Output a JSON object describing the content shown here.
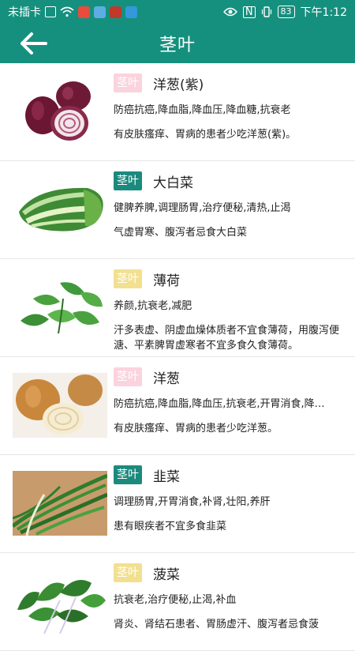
{
  "status_bar": {
    "carrier": "未插卡",
    "battery": "83",
    "time": "下午1:12"
  },
  "header": {
    "title": "茎叶"
  },
  "items": [
    {
      "badge": "茎叶",
      "badge_color": "#fbd3de",
      "name": "洋葱(紫)",
      "effect": "防癌抗癌,降血脂,降血压,降血糖,抗衰老",
      "avoid": "有皮肤瘙痒、胃病的患者少吃洋葱(紫)。",
      "image": "red-onion"
    },
    {
      "badge": "茎叶",
      "badge_color": "#1b8a7e",
      "name": "大白菜",
      "effect": "健脾养脾,调理肠胃,治疗便秘,清热,止渴",
      "avoid": "气虚胃寒、腹泻者忌食大白菜",
      "image": "napa-cabbage"
    },
    {
      "badge": "茎叶",
      "badge_color": "#f3e08f",
      "name": "薄荷",
      "effect": "养颜,抗衰老,减肥",
      "avoid": "汗多表虚、阴虚血燥体质者不宜食薄荷，用腹泻便溏、平素脾胃虚寒者不宜多食久食薄荷。",
      "image": "mint"
    },
    {
      "badge": "茎叶",
      "badge_color": "#fbd3de",
      "name": "洋葱",
      "effect": "防癌抗癌,降血脂,降血压,抗衰老,开胃消食,降…",
      "avoid": "有皮肤瘙痒、胃病的患者少吃洋葱。",
      "image": "onion"
    },
    {
      "badge": "茎叶",
      "badge_color": "#1b8a7e",
      "name": "韭菜",
      "effect": "调理肠胃,开胃消食,补肾,壮阳,养肝",
      "avoid": "患有眼疾者不宜多食韭菜",
      "image": "chives"
    },
    {
      "badge": "茎叶",
      "badge_color": "#f3e08f",
      "name": "菠菜",
      "effect": "抗衰老,治疗便秘,止渴,补血",
      "avoid": "肾炎、肾结石患者、胃肠虚汗、腹泻者忌食菠",
      "image": "spinach"
    }
  ]
}
